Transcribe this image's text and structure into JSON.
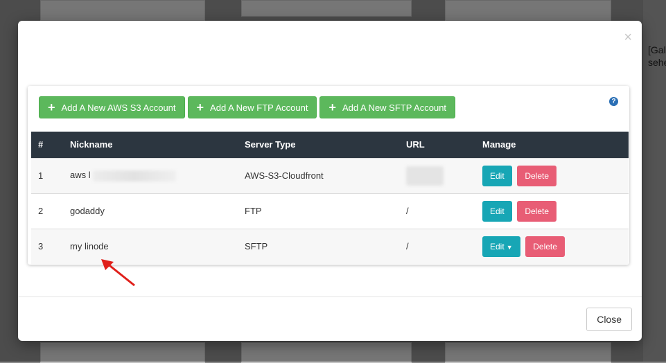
{
  "background": {
    "right_text": [
      "[Gal",
      "sehe"
    ]
  },
  "modal": {
    "close_glyph": "×",
    "buttons": [
      {
        "label": "Add A New AWS S3 Account"
      },
      {
        "label": "Add A New FTP Account"
      },
      {
        "label": "Add A New SFTP Account"
      }
    ],
    "help_glyph": "?",
    "table": {
      "headers": [
        "#",
        "Nickname",
        "Server Type",
        "URL",
        "Manage"
      ],
      "rows": [
        {
          "num": "1",
          "nickname": "aws l",
          "server_type": "AWS-S3-Cloudfront",
          "url": "",
          "edit": "Edit",
          "delete": "Delete"
        },
        {
          "num": "2",
          "nickname": "godaddy",
          "server_type": "FTP",
          "url": "/",
          "edit": "Edit",
          "delete": "Delete"
        },
        {
          "num": "3",
          "nickname": "my linode",
          "server_type": "SFTP",
          "url": "/",
          "edit": "Edit",
          "delete": "Delete"
        }
      ]
    },
    "close_label": "Close"
  },
  "colors": {
    "add_button": "#5cb85c",
    "edit_button": "#17a6b5",
    "delete_button": "#e85d75",
    "table_header": "#2c3640",
    "annotation_arrow": "#e0201b"
  }
}
